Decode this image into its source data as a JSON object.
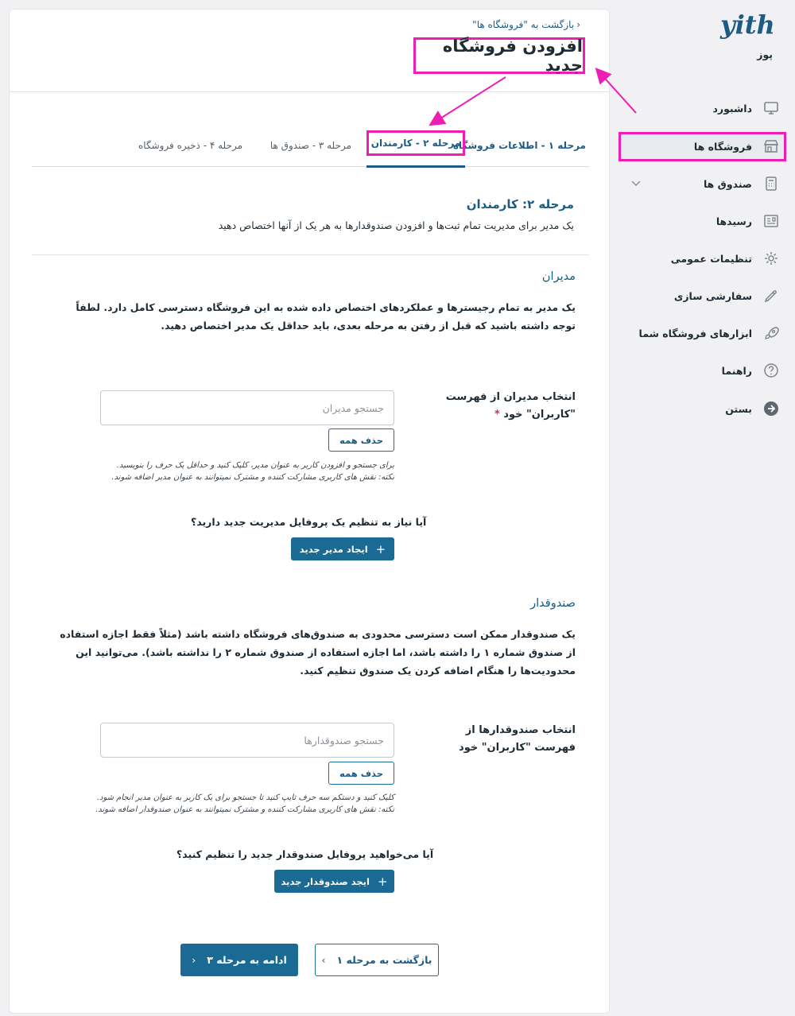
{
  "app": {
    "logo_text": "yith",
    "brand_sub": "پوز"
  },
  "header": {
    "back_link": "بازگشت به \"فروشگاه ها\"",
    "title": "افزودن فروشگاه جدید"
  },
  "tabs": [
    {
      "label": "مرحله ۱ - اطلاعات فروشگاه",
      "state": "done"
    },
    {
      "label": "مرحله ۲ - کارمندان",
      "state": "active"
    },
    {
      "label": "مرحله ۳ - صندوق ها",
      "state": "todo"
    },
    {
      "label": "مرحله ۴ - ذخیره فروشگاه",
      "state": "todo"
    }
  ],
  "step": {
    "heading": "مرحله ۲: کارمندان",
    "subtitle": "یک مدیر برای مدیریت تمام ثبت‌ها و افزودن صندوقدارها به هر یک از آنها اختصاص دهید"
  },
  "managers": {
    "title": "مدیران",
    "desc": "یک مدیر به تمام رجیسترها و عملکردهای اختصاص داده شده به این فروشگاه دسترسی کامل دارد. لطفاً توجه داشته باشید که قبل از رفتن به مرحله بعدی، باید حداقل یک مدیر اختصاص دهید.",
    "field_label": "انتخاب مدیران از فهرست \"کاربران\" خود",
    "required_mark": "*",
    "search_placeholder": "جستجو مدیران",
    "search_value": "",
    "clear_label": "حذف همه",
    "hint_line1": "برای جستجو و افزودن کاربر به عنوان مدیر، کلیک کنید و حداقل یک حرف را بنویسید.",
    "hint_line2": "نکته: نقش های کاربری مشارکت کننده و مشترک نمیتوانند به عنوان مدیر اضافه شوند.",
    "question": "آیا نیاز به تنظیم یک پروفایل مدیریت جدید دارید؟",
    "create_label": "ایجاد مدیر جدید",
    "create_icon": "+"
  },
  "cashiers": {
    "title": "صندوقدار",
    "desc": "یک صندوقدار ممکن است دسترسی محدودی به صندوق‌های فروشگاه داشته باشد (مثلاً فقط اجازه استفاده از صندوق شماره ۱ را داشته باشد، اما اجازه استفاده از صندوق شماره ۲ را نداشته باشد). می‌توانید این محدودیت‌ها را هنگام اضافه کردن یک صندوق تنظیم کنید.",
    "field_label": "انتخاب صندوقدارها از فهرست \"کاربران\" خود",
    "search_placeholder": "جستجو صندوقدارها",
    "search_value": "",
    "clear_label": "حذف همه",
    "hint_line1": "کلیک کنید و دستکم سه حرف تایپ کنید تا جستجو برای یک کاربر به عنوان مدیر انجام شود.",
    "hint_line2": "نکته: نقش های کاربری مشارکت کننده و مشترک نمیتوانند به عنوان صندوقدار اضافه شوند.",
    "question": "آیا می‌خواهید پروفایل صندوقدار جدید را تنظیم کنید؟",
    "create_label": "ایجد صندوقدار جدید",
    "create_icon": "+"
  },
  "footer_nav": {
    "back_label": "بازگشت به مرحله ۱",
    "next_label": "ادامه به مرحله ۳"
  },
  "sidebar": {
    "items": [
      {
        "label": "داشبورد",
        "icon": "monitor-icon"
      },
      {
        "label": "فروشگاه ها",
        "icon": "store-icon",
        "active": true
      },
      {
        "label": "صندوق ها",
        "icon": "calculator-icon",
        "expandable": true
      },
      {
        "label": "رسیدها",
        "icon": "receipt-icon"
      },
      {
        "label": "تنظیمات عمومی",
        "icon": "gear-icon"
      },
      {
        "label": "سفارشی سازی",
        "icon": "dropper-icon"
      },
      {
        "label": "ابزارهای فروشگاه شما",
        "icon": "rocket-icon"
      },
      {
        "label": "راهنما",
        "icon": "help-icon"
      },
      {
        "label": "بستن",
        "icon": "close-arrow-icon"
      }
    ]
  },
  "colors": {
    "accent": "#1c5b83",
    "primary_button": "#1a6a93",
    "highlight": "#ee1eb4",
    "active_menu_bg": "#e7eaef"
  }
}
